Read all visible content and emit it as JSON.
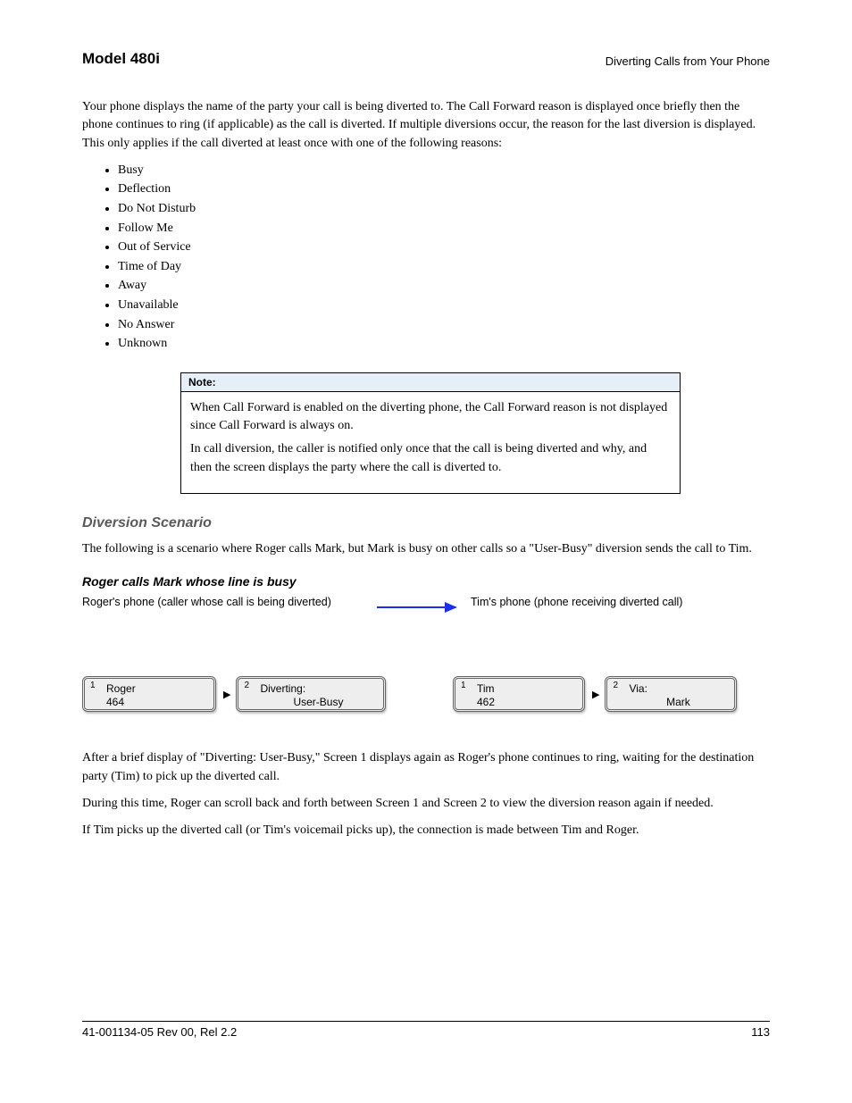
{
  "header": {
    "left": "Model 480i",
    "right": "Diverting Calls from Your Phone"
  },
  "intro": {
    "para1": "Your phone displays the name of the party your call is being diverted to. The Call Forward reason is displayed once briefly then the phone continues to ring (if applicable) as the call is diverted. If multiple diversions occur, the reason for the last diversion is displayed. This only applies if the call diverted at least once with one of the following reasons:",
    "reasons": [
      "Busy",
      "Deflection",
      "Do Not Disturb",
      "Follow Me",
      "Out of Service",
      "Time of Day",
      "Away",
      "Unavailable",
      "No Answer",
      "Unknown"
    ]
  },
  "note": {
    "label": "Note:",
    "line1": "When Call Forward is enabled on the diverting phone, the Call Forward reason is not displayed since Call Forward is always on.",
    "line2": "In call diversion, the caller is notified only once that the call is being diverted and why, and then the screen displays the party where the call is diverted to."
  },
  "scenario": {
    "heading": "Diversion Scenario",
    "intro": "The following is a scenario where Roger calls Mark, but Mark is busy on other calls so a \"User-Busy\" diversion sends the call to Tim.",
    "h4": "Roger calls Mark whose line is busy",
    "labels": {
      "phone1": "Roger's phone (caller whose call is being diverted)",
      "phone2": "Tim's phone (phone receiving diverted call)"
    },
    "roger": {
      "screen1_num": "1",
      "screen1_l1": "Roger",
      "screen1_l2": "464",
      "screen2_num": "2",
      "screen2_l1": "Diverting:",
      "screen2_l2": "User-Busy"
    },
    "tim": {
      "screen1_num": "1",
      "screen1_l1": "Tim",
      "screen1_l2": "462",
      "screen2_num": "2",
      "screen2_l1": "Via:",
      "screen2_l2": "Mark"
    },
    "after1": "After a brief display of \"Diverting: User-Busy,\" Screen 1 displays again as Roger's phone continues to ring, waiting for the destination party (Tim) to pick up the diverted call.",
    "after2": "During this time, Roger can scroll back and forth between Screen 1 and Screen 2 to view the diversion reason again if needed.",
    "after3": "If Tim picks up the diverted call (or Tim's voicemail picks up), the connection is made between Tim and Roger."
  },
  "footer": {
    "left": "41-001134-05 Rev 00, Rel 2.2",
    "right": "113"
  }
}
